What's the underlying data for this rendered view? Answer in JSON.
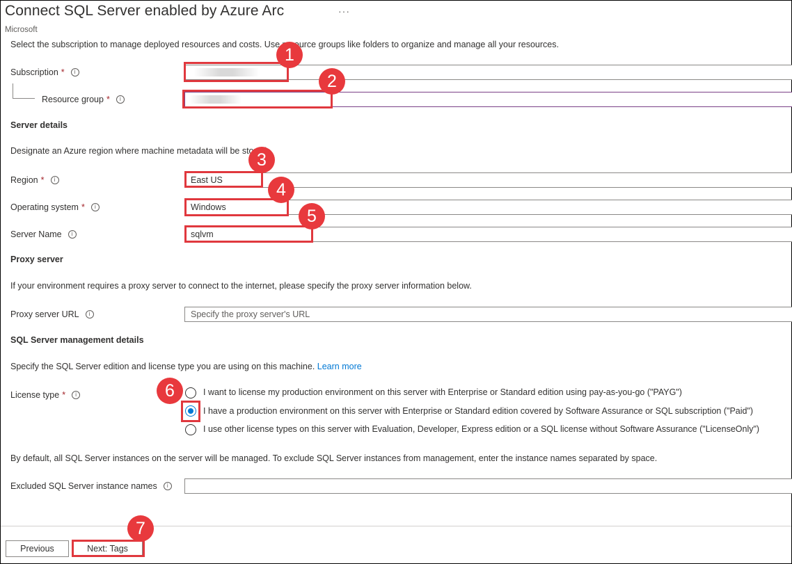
{
  "header": {
    "title": "Connect SQL Server enabled by Azure Arc",
    "more_label": "···",
    "publisher": "Microsoft"
  },
  "intro_text": "Select the subscription to manage deployed resources and costs. Use resource groups like folders to organize and manage all your resources.",
  "required_marker": "*",
  "info_glyph": "i",
  "subscription": {
    "label": "Subscription"
  },
  "resource_group": {
    "label": "Resource group"
  },
  "server_details": {
    "heading": "Server details",
    "description": "Designate an Azure region where machine metadata will be stored.",
    "region": {
      "label": "Region",
      "value": "East US"
    },
    "operating_system": {
      "label": "Operating system",
      "value": "Windows"
    },
    "server_name": {
      "label": "Server Name",
      "value": "sqlvm"
    }
  },
  "proxy": {
    "heading": "Proxy server",
    "description": "If your environment requires a proxy server to connect to the internet, please specify the proxy server information below.",
    "url_label": "Proxy server URL",
    "url_placeholder": "Specify the proxy server's URL"
  },
  "sql_management": {
    "heading": "SQL Server management details",
    "description": "Specify the SQL Server edition and license type you are using on this machine.",
    "learn_more": "Learn more",
    "license_label": "License type",
    "license_options": [
      {
        "label": "I want to license my production environment on this server with Enterprise or Standard edition using pay-as-you-go (\"PAYG\")",
        "selected": false
      },
      {
        "label": "I have a production environment on this server with Enterprise or Standard edition covered by Software Assurance or SQL subscription (\"Paid\")",
        "selected": true
      },
      {
        "label": "I use other license types on this server with Evaluation, Developer, Express edition or a SQL license without Software Assurance (\"LicenseOnly\")",
        "selected": false
      }
    ],
    "exclude_description": "By default, all SQL Server instances on the server will be managed. To exclude SQL Server instances from management, enter the instance names separated by space.",
    "excluded_label": "Excluded SQL Server instance names",
    "excluded_value": ""
  },
  "footer": {
    "previous_label": "Previous",
    "next_label": "Next: Tags"
  },
  "annotations": [
    "1",
    "2",
    "3",
    "4",
    "5",
    "6",
    "7"
  ],
  "colors": {
    "accent": "#0078d4",
    "highlight": "#e0383e",
    "badge": "#e8393d",
    "required": "#a4262c"
  }
}
